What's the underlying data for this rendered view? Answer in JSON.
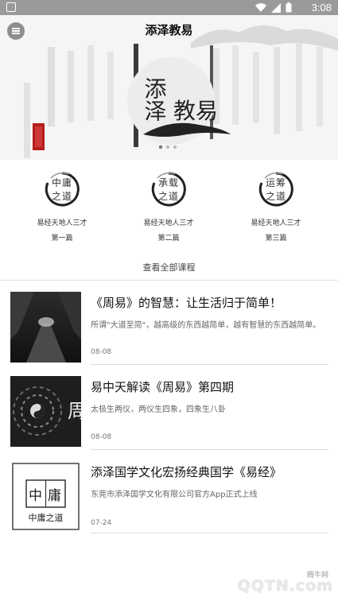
{
  "status_bar": {
    "time": "3:08"
  },
  "header": {
    "title": "添泽教易"
  },
  "hero": {
    "calligraphy": "添泽教易"
  },
  "courses": [
    {
      "badge": "中庸之道",
      "badge_line1": "中庸",
      "badge_line2": "之道",
      "title": "易经天地人三才",
      "subtitle": "第一篇"
    },
    {
      "badge": "承载之道",
      "badge_line1": "承载",
      "badge_line2": "之道",
      "title": "易经天地人三才",
      "subtitle": "第二篇"
    },
    {
      "badge": "运筹之道",
      "badge_line1": "运筹",
      "badge_line2": "之道",
      "title": "易经天地人三才",
      "subtitle": "第三篇"
    }
  ],
  "view_all_label": "查看全部课程",
  "articles": [
    {
      "title": "《周易》的智慧：让生活归于简单！",
      "desc": "所谓\"大道至简\"，越高级的东西越简单，越有智慧的东西越简单。",
      "date": "08-08"
    },
    {
      "title": "易中天解读《周易》第四期",
      "desc": "太极生两仪，两仪生四象，四象生八卦",
      "date": "08-08"
    },
    {
      "title": "添泽国学文化宏扬经典国学《易经》",
      "desc": "东莞市添泽国学文化有限公司官方App正式上线",
      "date": "07-24"
    }
  ],
  "thumb3": {
    "glyph1": "中",
    "glyph2": "庸",
    "caption": "中庸之道"
  },
  "thumb2": {
    "glyph": "周"
  },
  "watermark": {
    "main": "QQTN.com",
    "small": "腾牛网"
  }
}
